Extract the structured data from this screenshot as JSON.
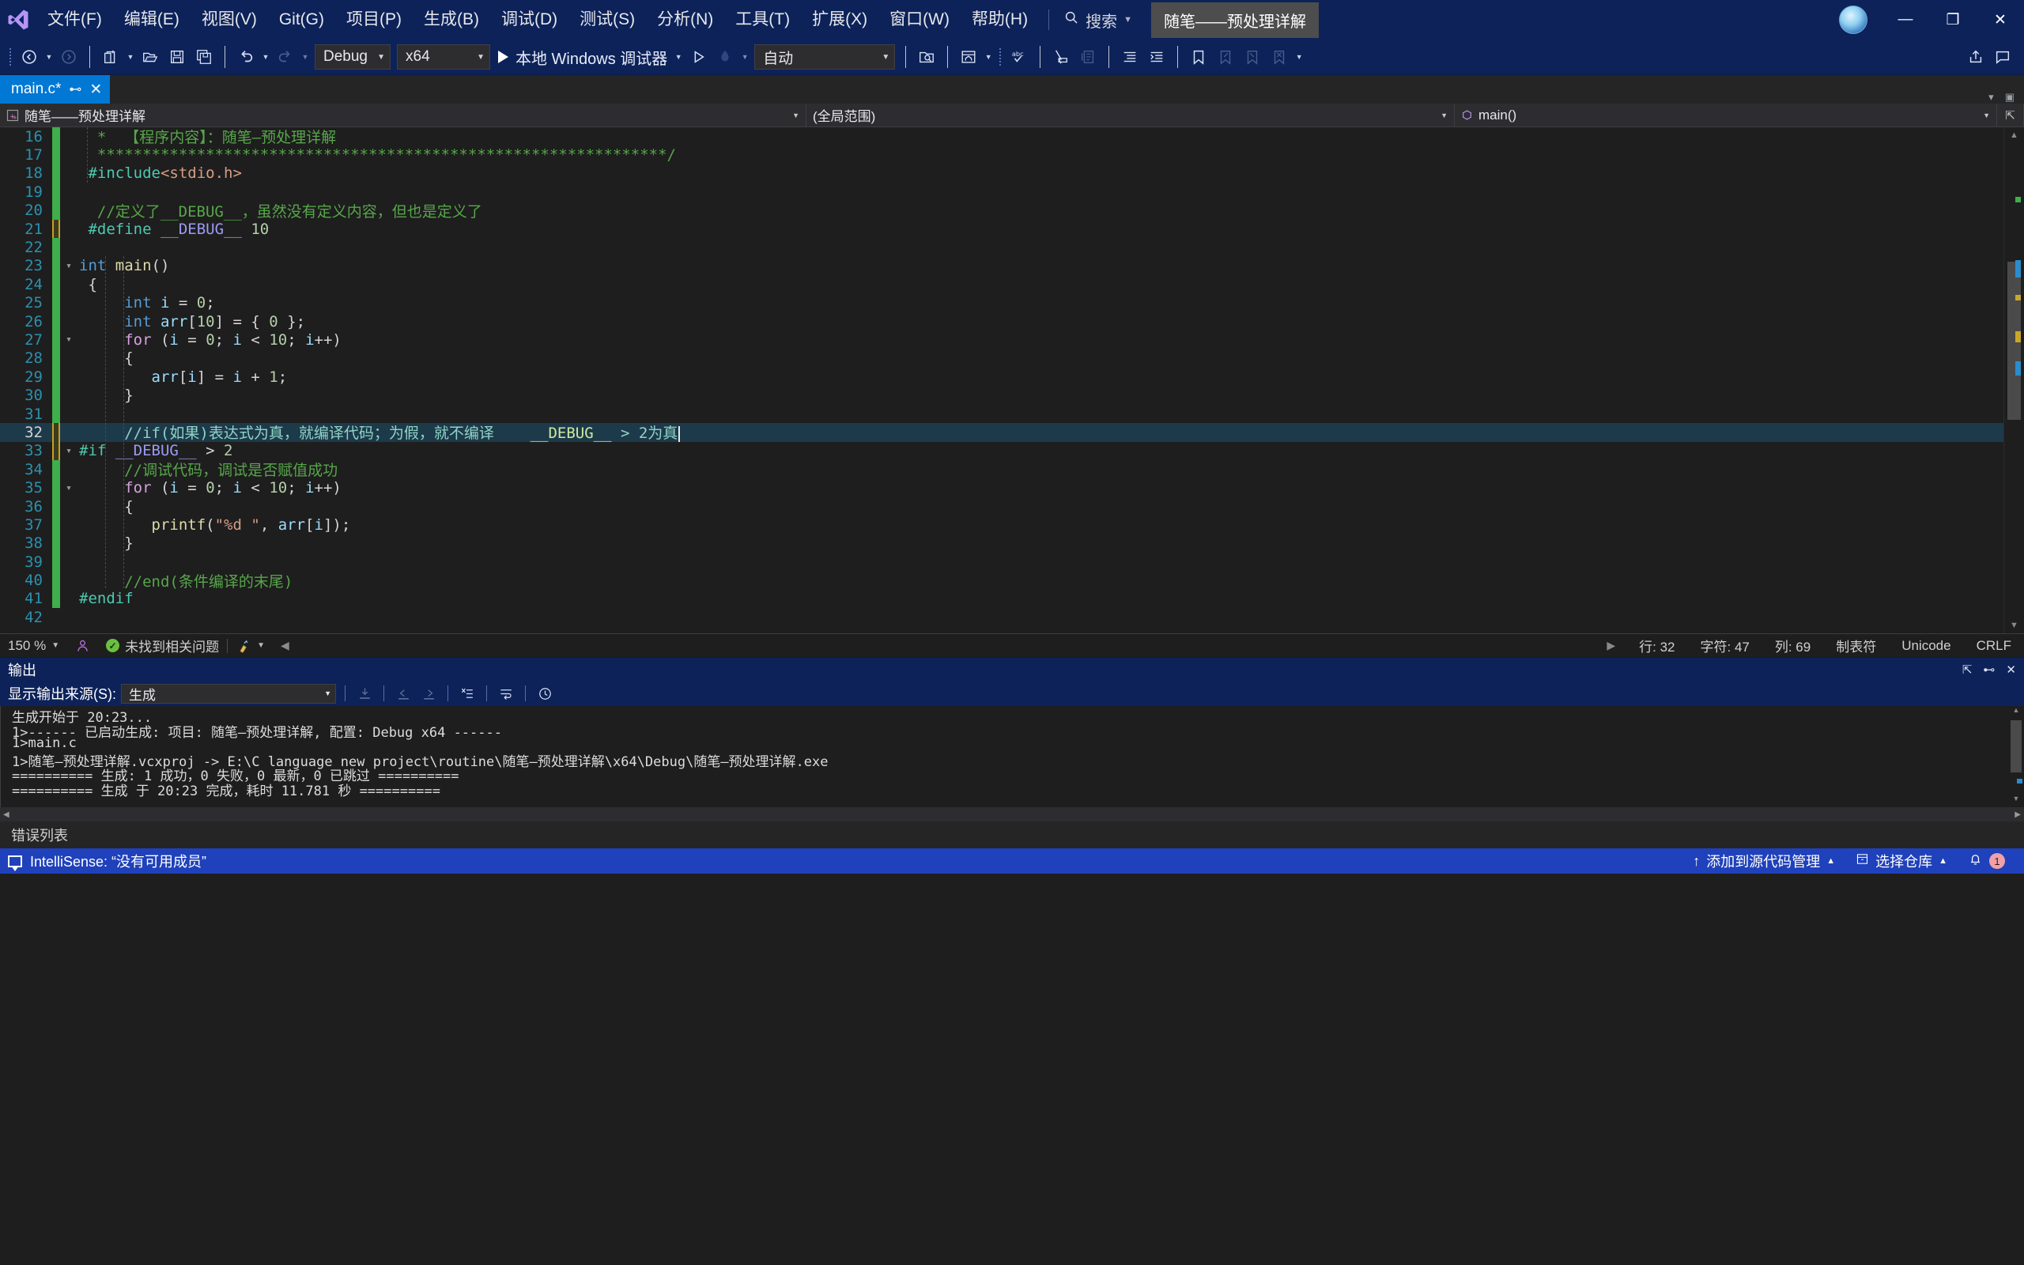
{
  "titlebar": {
    "logo_icon": "visual-studio-logo",
    "menus": [
      "文件(F)",
      "编辑(E)",
      "视图(V)",
      "Git(G)",
      "项目(P)",
      "生成(B)",
      "调试(D)",
      "测试(S)",
      "分析(N)",
      "工具(T)",
      "扩展(X)",
      "窗口(W)",
      "帮助(H)"
    ],
    "search_label": "搜索",
    "search_icon": "search-icon",
    "project_chip": "随笔——预处理详解",
    "avatar_icon": "user-avatar",
    "minimize": "—",
    "restore": "❐",
    "close": "✕"
  },
  "toolbar": {
    "nav_back_icon": "navigate-back-icon",
    "nav_forward_icon": "navigate-forward-icon",
    "new_item_icon": "new-item-icon",
    "open_file_icon": "open-file-icon",
    "save_icon": "save-icon",
    "save_all_icon": "save-all-icon",
    "undo_icon": "undo-icon",
    "redo_icon": "redo-icon",
    "config_value": "Debug",
    "platform_value": "x64",
    "run_label": "本地 Windows 调试器",
    "run_icon": "play-icon",
    "start_no_debug_icon": "play-outline-icon",
    "hot_reload_icon": "hot-reload-icon",
    "auto_value": "自动",
    "find_in_files_icon": "find-in-files-icon",
    "solution_explorer_icon": "solution-explorer-icon",
    "spellcheck_icon": "spellcheck-abc-icon",
    "select_icon": "pointer-select-icon",
    "comment_icon": "comment-block-icon",
    "indent_icon": "increase-indent-icon",
    "outdent_icon": "decrease-indent-icon",
    "bookmark_icon": "bookmark-icon",
    "prev_bookmark_icon": "previous-bookmark-icon",
    "next_bookmark_icon": "next-bookmark-icon",
    "clear_bookmark_icon": "clear-bookmarks-icon",
    "overflow_icon": "toolbar-overflow-icon",
    "share_icon": "share-icon",
    "feedback_icon": "feedback-icon"
  },
  "tabs": {
    "active_tab": "main.c*",
    "pin_icon": "pin-icon",
    "close_icon": "close-tab-icon"
  },
  "navbar": {
    "project_scope": "随笔——预处理详解",
    "project_icon": "cpp-project-icon",
    "member_scope": "(全局范围)",
    "function_scope": "main()",
    "function_icon": "method-icon",
    "split_icon": "split-window-icon"
  },
  "editor": {
    "first_line": 16,
    "lines": [
      {
        "n": 16,
        "mark": "green",
        "fold": "",
        "tokens": [
          {
            "t": "cm",
            "v": "  *  【程序内容】：随笔—预处理详解"
          }
        ]
      },
      {
        "n": 17,
        "mark": "green",
        "fold": "",
        "tokens": [
          {
            "t": "cm",
            "v": "  ***************************************************************/"
          }
        ]
      },
      {
        "n": 18,
        "mark": "green",
        "fold": "",
        "tokens": [
          {
            "t": "kc",
            "v": " #include"
          },
          {
            "t": "st",
            "v": "<stdio.h>"
          }
        ]
      },
      {
        "n": 19,
        "mark": "green",
        "fold": "",
        "tokens": [
          {
            "t": "pl",
            "v": ""
          }
        ]
      },
      {
        "n": 20,
        "mark": "green",
        "fold": "",
        "tokens": [
          {
            "t": "cm",
            "v": "  //定义了__DEBUG__，虽然没有定义内容，但也是定义了"
          }
        ]
      },
      {
        "n": 21,
        "mark": "orange",
        "fold": "",
        "tokens": [
          {
            "t": "kc",
            "v": " #define "
          },
          {
            "t": "pp",
            "v": "__DEBUG__"
          },
          {
            "t": "pl",
            "v": " "
          },
          {
            "t": "nm",
            "v": "10"
          }
        ]
      },
      {
        "n": 22,
        "mark": "green",
        "fold": "",
        "tokens": [
          {
            "t": "pl",
            "v": ""
          }
        ]
      },
      {
        "n": 23,
        "mark": "green",
        "fold": "▾",
        "tokens": [
          {
            "t": "k",
            "v": "int "
          },
          {
            "t": "fn",
            "v": "main"
          },
          {
            "t": "pl",
            "v": "()"
          }
        ]
      },
      {
        "n": 24,
        "mark": "green",
        "fold": "",
        "tokens": [
          {
            "t": "pl",
            "v": " {"
          }
        ]
      },
      {
        "n": 25,
        "mark": "green",
        "fold": "",
        "tokens": [
          {
            "t": "k",
            "v": "     int "
          },
          {
            "t": "id",
            "v": "i"
          },
          {
            "t": "pl",
            "v": " = "
          },
          {
            "t": "nm",
            "v": "0"
          },
          {
            "t": "pl",
            "v": ";"
          }
        ]
      },
      {
        "n": 26,
        "mark": "green",
        "fold": "",
        "tokens": [
          {
            "t": "k",
            "v": "     int "
          },
          {
            "t": "id",
            "v": "arr"
          },
          {
            "t": "pl",
            "v": "["
          },
          {
            "t": "nm",
            "v": "10"
          },
          {
            "t": "pl",
            "v": "] = { "
          },
          {
            "t": "nm",
            "v": "0"
          },
          {
            "t": "pl",
            "v": " };"
          }
        ]
      },
      {
        "n": 27,
        "mark": "green",
        "fold": "▾",
        "tokens": [
          {
            "t": "ctl",
            "v": "     for "
          },
          {
            "t": "pl",
            "v": "("
          },
          {
            "t": "id",
            "v": "i"
          },
          {
            "t": "pl",
            "v": " = "
          },
          {
            "t": "nm",
            "v": "0"
          },
          {
            "t": "pl",
            "v": "; "
          },
          {
            "t": "id",
            "v": "i"
          },
          {
            "t": "pl",
            "v": " < "
          },
          {
            "t": "nm",
            "v": "10"
          },
          {
            "t": "pl",
            "v": "; "
          },
          {
            "t": "id",
            "v": "i"
          },
          {
            "t": "pl",
            "v": "++)"
          }
        ]
      },
      {
        "n": 28,
        "mark": "green",
        "fold": "",
        "tokens": [
          {
            "t": "pl",
            "v": "     {"
          }
        ]
      },
      {
        "n": 29,
        "mark": "green",
        "fold": "",
        "tokens": [
          {
            "t": "id",
            "v": "        arr"
          },
          {
            "t": "pl",
            "v": "["
          },
          {
            "t": "id",
            "v": "i"
          },
          {
            "t": "pl",
            "v": "] = "
          },
          {
            "t": "id",
            "v": "i"
          },
          {
            "t": "pl",
            "v": " + "
          },
          {
            "t": "nm",
            "v": "1"
          },
          {
            "t": "pl",
            "v": ";"
          }
        ]
      },
      {
        "n": 30,
        "mark": "green",
        "fold": "",
        "tokens": [
          {
            "t": "pl",
            "v": "     }"
          }
        ]
      },
      {
        "n": 31,
        "mark": "green",
        "fold": "",
        "tokens": [
          {
            "t": "pl",
            "v": ""
          }
        ]
      },
      {
        "n": 32,
        "mark": "orange",
        "fold": "",
        "current": true,
        "tokens": [
          {
            "t": "cmsel",
            "v": "     //if(如果)表达式为真，就编译代码；为假，就不编译    "
          },
          {
            "t": "ppsel",
            "v": "__DEBUG__"
          },
          {
            "t": "cmsel",
            "v": " > 2为真"
          }
        ],
        "caret": true
      },
      {
        "n": 33,
        "mark": "orange",
        "fold": "▾",
        "tokens": [
          {
            "t": "kc",
            "v": "#if "
          },
          {
            "t": "pp",
            "v": "__DEBUG__"
          },
          {
            "t": "pl",
            "v": " > "
          },
          {
            "t": "nm",
            "v": "2"
          }
        ]
      },
      {
        "n": 34,
        "mark": "green",
        "fold": "",
        "tokens": [
          {
            "t": "cm",
            "v": "     //调试代码，调试是否赋值成功"
          }
        ]
      },
      {
        "n": 35,
        "mark": "green",
        "fold": "▾",
        "tokens": [
          {
            "t": "ctl",
            "v": "     for "
          },
          {
            "t": "pl",
            "v": "("
          },
          {
            "t": "id",
            "v": "i"
          },
          {
            "t": "pl",
            "v": " = "
          },
          {
            "t": "nm",
            "v": "0"
          },
          {
            "t": "pl",
            "v": "; "
          },
          {
            "t": "id",
            "v": "i"
          },
          {
            "t": "pl",
            "v": " < "
          },
          {
            "t": "nm",
            "v": "10"
          },
          {
            "t": "pl",
            "v": "; "
          },
          {
            "t": "id",
            "v": "i"
          },
          {
            "t": "pl",
            "v": "++)"
          }
        ]
      },
      {
        "n": 36,
        "mark": "green",
        "fold": "",
        "tokens": [
          {
            "t": "pl",
            "v": "     {"
          }
        ]
      },
      {
        "n": 37,
        "mark": "green",
        "fold": "",
        "tokens": [
          {
            "t": "fn",
            "v": "        printf"
          },
          {
            "t": "pl",
            "v": "("
          },
          {
            "t": "st",
            "v": "\"%d \""
          },
          {
            "t": "pl",
            "v": ", "
          },
          {
            "t": "id",
            "v": "arr"
          },
          {
            "t": "pl",
            "v": "["
          },
          {
            "t": "id",
            "v": "i"
          },
          {
            "t": "pl",
            "v": "]);"
          }
        ]
      },
      {
        "n": 38,
        "mark": "green",
        "fold": "",
        "tokens": [
          {
            "t": "pl",
            "v": "     }"
          }
        ]
      },
      {
        "n": 39,
        "mark": "green",
        "fold": "",
        "tokens": [
          {
            "t": "pl",
            "v": ""
          }
        ]
      },
      {
        "n": 40,
        "mark": "green",
        "fold": "",
        "tokens": [
          {
            "t": "cm",
            "v": "     //end(条件编译的末尾)"
          }
        ]
      },
      {
        "n": 41,
        "mark": "green",
        "fold": "",
        "tokens": [
          {
            "t": "kc",
            "v": "#endif"
          }
        ]
      },
      {
        "n": 42,
        "mark": "",
        "fold": "",
        "tokens": [
          {
            "t": "pl",
            "v": ""
          }
        ]
      }
    ]
  },
  "editor_status": {
    "zoom": "150 %",
    "zoom_caret": "▾",
    "intellisense_icon": "intellisense-person-icon",
    "problems_icon": "check-circle-icon",
    "problems_text": "未找到相关问题",
    "broom_icon": "code-cleanup-icon",
    "prev_icon": "scroll-left-icon",
    "next_icon": "scroll-right-icon",
    "line_label": "行: 32",
    "char_label": "字符: 47",
    "col_label": "列: 69",
    "tab_label": "制表符",
    "encoding": "Unicode",
    "eol": "CRLF"
  },
  "output": {
    "title": "输出",
    "float_icon": "float-window-icon",
    "pin_icon": "pin-icon",
    "close_icon": "close-icon",
    "source_label": "显示输出来源(S):",
    "source_value": "生成",
    "clear_icon": "clear-pane-icon",
    "goto_prev_icon": "go-to-previous-message-icon",
    "goto_next_icon": "go-to-next-message-icon",
    "clear_all_icon": "clear-all-icon",
    "wrap_icon": "toggle-word-wrap-icon",
    "history_icon": "history-icon",
    "lines": [
      "生成开始于 20:23...",
      "1>------ 已启动生成: 项目: 随笔—预处理详解, 配置: Debug x64 ------",
      "1>main.c",
      "1>随笔—预处理详解.vcxproj -> E:\\C language new project\\routine\\随笔—预处理详解\\x64\\Debug\\随笔—预处理详解.exe",
      "========== 生成: 1 成功，0 失败，0 最新，0 已跳过 ==========",
      "========== 生成 于 20:23 完成，耗时 11.781 秒 =========="
    ]
  },
  "errorlist": {
    "title": "错误列表"
  },
  "statusbar": {
    "message_icon": "intellisense-balloon-icon",
    "message": "IntelliSense: “没有可用成员”",
    "source_control_icon": "add-to-source-control-icon",
    "source_control": "添加到源代码管理",
    "repo_icon": "repository-icon",
    "repo_label": "选择仓库",
    "notify_icon": "bell-icon",
    "notify_count": "1"
  },
  "colors": {
    "accent_blue": "#1f41bb",
    "title_blue": "#0c2259",
    "tab_active": "#0078d4",
    "editor_bg": "#1e1e1e",
    "current_line": "#1d3a4a",
    "changed_mark": "#3fae4b",
    "unsaved_mark": "#c8a020"
  }
}
